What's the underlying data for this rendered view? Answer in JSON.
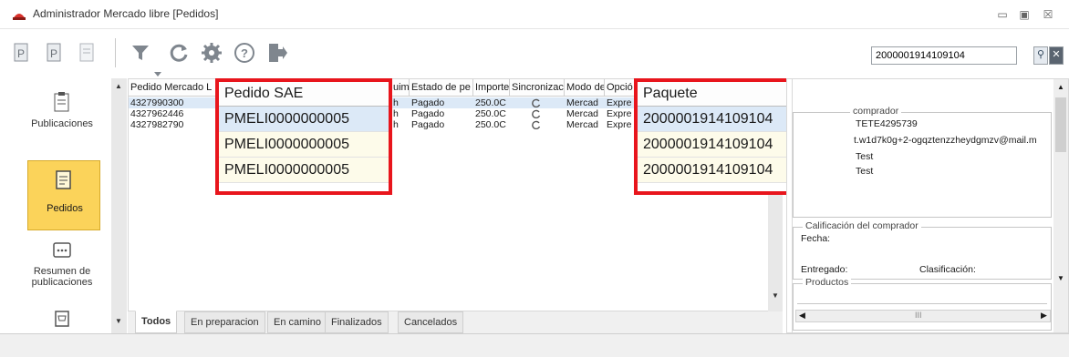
{
  "window": {
    "title": "Administrador Mercado libre [Pedidos]",
    "controls": [
      "minimize",
      "maximize",
      "close"
    ]
  },
  "toolbar": {
    "search_value": "2000001914109104",
    "icons": [
      "import-product-icon",
      "product-icon",
      "document-icon",
      "filter-icon",
      "refresh-icon",
      "settings-icon",
      "help-icon",
      "exit-icon"
    ]
  },
  "nav": {
    "items": [
      {
        "label": "Publicaciones",
        "icon": "clipboard-icon"
      },
      {
        "label": "Pedidos",
        "icon": "orders-icon",
        "active": true
      },
      {
        "label": "Resumen de publicaciones",
        "icon": "chat-icon"
      },
      {
        "label": "",
        "icon": "cart-icon"
      }
    ]
  },
  "grid": {
    "headers": [
      "Pedido Mercado L",
      "uim",
      "Estado de pe",
      "Importe",
      "Sincronizac",
      "Modo de",
      "Opció"
    ],
    "rows": [
      {
        "pedido": "4327990300",
        "a": "h",
        "estado": "Pagado",
        "importe": "250.0C",
        "modo": "Mercad",
        "opcion": "Expre"
      },
      {
        "pedido": "4327962446",
        "a": "h",
        "estado": "Pagado",
        "importe": "250.0C",
        "modo": "Mercad",
        "opcion": "Expre"
      },
      {
        "pedido": "4327982790",
        "a": "h",
        "estado": "Pagado",
        "importe": "250.0C",
        "modo": "Mercad",
        "opcion": "Expre"
      }
    ]
  },
  "zoom_sae": {
    "header": "Pedido SAE",
    "values": [
      "PMELI0000000005",
      "PMELI0000000005",
      "PMELI0000000005"
    ]
  },
  "zoom_paquete": {
    "header": "Paquete",
    "values": [
      "2000001914109104",
      "2000001914109104",
      "2000001914109104"
    ]
  },
  "tabs": [
    "Todos",
    "En preparacion",
    "En camino",
    "Finalizados",
    "Cancelados"
  ],
  "comprador": {
    "group_label": "comprador",
    "line1": "TETE4295739",
    "line2": "t.w1d7k0g+2-ogqztenzzheydgmzv@mail.m",
    "line3": "Test",
    "line4": "Test"
  },
  "calificacion": {
    "group_label": "Calificación del comprador",
    "fecha_label": "Fecha:",
    "entregado_label": "Entregado:",
    "clasificacion_label": "Clasificación:"
  },
  "productos": {
    "group_label": "Productos",
    "scroll_mark": "III"
  },
  "colors": {
    "highlight_red": "#e8151c",
    "nav_active": "#fbd35a"
  }
}
